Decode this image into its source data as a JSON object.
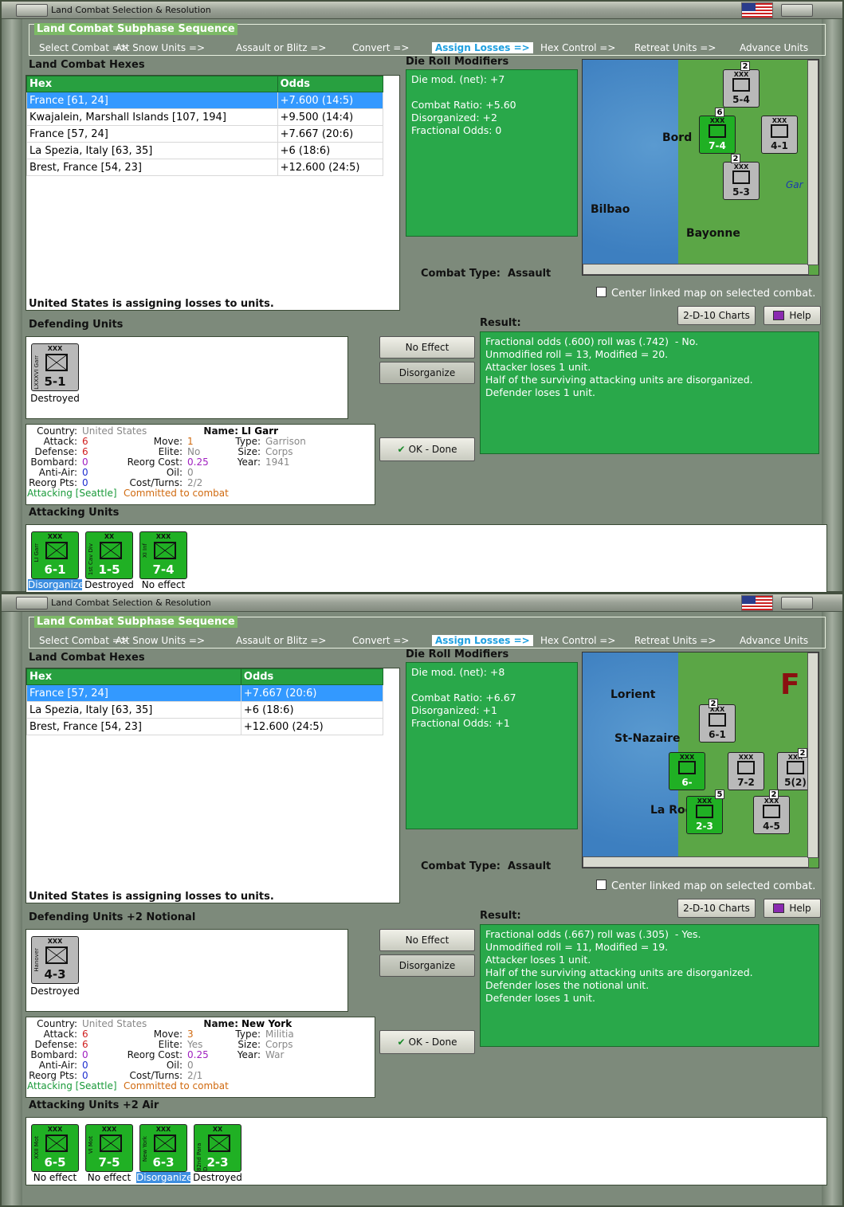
{
  "windows": [
    {
      "title": "Land Combat Selection & Resolution",
      "seq_title": "Land Combat Subphase Sequence",
      "sequence": [
        "Select Combat =>",
        "Att Snow Units =>",
        "Assault or Blitz =>",
        "Convert =>",
        "Assign Losses =>",
        "Hex Control =>",
        "Retreat Units =>",
        "Advance Units"
      ],
      "active_step": "Assign Losses =>",
      "hexes_label": "Land Combat Hexes",
      "col_hex": "Hex",
      "col_odds": "Odds",
      "hexes": [
        {
          "hex": "France [61, 24]",
          "odds": "+7.600 (14:5)"
        },
        {
          "hex": "Kwajalein, Marshall Islands [107, 194]",
          "odds": "+9.500 (14:4)"
        },
        {
          "hex": "France [57, 24]",
          "odds": "+7.667 (20:6)"
        },
        {
          "hex": "La Spezia, Italy [63, 35]",
          "odds": "+6 (18:6)"
        },
        {
          "hex": "Brest, France [54, 23]",
          "odds": "+12.600 (24:5)"
        }
      ],
      "drm_label": "Die Roll Modifiers",
      "drm": [
        "Die mod. (net): +7",
        "",
        "Combat Ratio: +5.60",
        "Disorganized: +2",
        "Fractional Odds: 0"
      ],
      "combat_type_label": "Combat Type:",
      "combat_type": "Assault",
      "center_map": "Center linked map on selected combat.",
      "assign_msg": "United States is assigning losses to units.",
      "defending_label": "Defending Units",
      "defender": {
        "name": "LXXXVI Garr",
        "size": "XXX",
        "strength": "5-1",
        "status": "Destroyed"
      },
      "charts_btn": "2-D-10 Charts",
      "help_btn": "Help",
      "no_effect_btn": "No Effect",
      "disorganize_btn": "Disorganize",
      "ok_btn": "OK - Done",
      "result_label": "Result:",
      "result": [
        "Fractional odds (.600) roll was (.742)  - No.",
        "Unmodified roll = 13, Modified = 20.",
        "Attacker loses 1 unit.",
        "Half of the surviving attacking units are disorganized.",
        "Defender loses 1 unit."
      ],
      "info": {
        "country_k": "Country:",
        "country": "United States",
        "name_k": "Name:",
        "name": "LI Garr",
        "attack_k": "Attack:",
        "attack": "6",
        "move_k": "Move:",
        "move": "1",
        "type_k": "Type:",
        "type": "Garrison",
        "defense_k": "Defense:",
        "defense": "6",
        "elite_k": "Elite:",
        "elite": "No",
        "size_k": "Size:",
        "size": "Corps",
        "bombard_k": "Bombard:",
        "bombard": "0",
        "reorg_k": "Reorg Cost:",
        "reorg": "0.25",
        "year_k": "Year:",
        "year": "1941",
        "aa_k": "Anti-Air:",
        "aa": "0",
        "oil_k": "Oil:",
        "oil": "0",
        "rp_k": "Reorg Pts:",
        "rp": "0",
        "ct_k": "Cost/Turns:",
        "ct": "2/2",
        "attacking": "Attacking [Seattle]",
        "committed": "Committed to combat"
      },
      "attacking_label": "Attacking Units",
      "attackers": [
        {
          "name": "LI Garr",
          "size": "XXX",
          "strength": "6-1",
          "status": "Disorganized",
          "sel": true
        },
        {
          "name": "1st Cav Div",
          "size": "XX",
          "strength": "1-5",
          "status": "Destroyed",
          "sel": false
        },
        {
          "name": "XI Inf",
          "size": "XXX",
          "strength": "7-4",
          "status": "No effect",
          "sel": false
        }
      ],
      "map": {
        "cities": [
          "Bord",
          "Bilbao",
          "Bayonne",
          "Gar"
        ],
        "units": [
          "5-4",
          "7-4",
          "4-1",
          "5-3"
        ],
        "markers": [
          "2",
          "6",
          "2"
        ]
      }
    },
    {
      "title": "Land Combat Selection & Resolution",
      "seq_title": "Land Combat Subphase Sequence",
      "sequence": [
        "Select Combat =>",
        "Att Snow Units =>",
        "Assault or Blitz =>",
        "Convert =>",
        "Assign Losses =>",
        "Hex Control =>",
        "Retreat Units =>",
        "Advance Units"
      ],
      "active_step": "Assign Losses =>",
      "hexes_label": "Land Combat Hexes",
      "col_hex": "Hex",
      "col_odds": "Odds",
      "hexes": [
        {
          "hex": "France [57, 24]",
          "odds": "+7.667 (20:6)"
        },
        {
          "hex": "La Spezia, Italy [63, 35]",
          "odds": "+6 (18:6)"
        },
        {
          "hex": "Brest, France [54, 23]",
          "odds": "+12.600 (24:5)"
        }
      ],
      "drm_label": "Die Roll Modifiers",
      "drm": [
        "Die mod. (net): +8",
        "",
        "Combat Ratio: +6.67",
        "Disorganized: +1",
        "Fractional Odds: +1"
      ],
      "combat_type_label": "Combat Type:",
      "combat_type": "Assault",
      "center_map": "Center linked map on selected combat.",
      "assign_msg": "United States is assigning losses to units.",
      "defending_label": "Defending Units +2 Notional",
      "defender": {
        "name": "Hanover",
        "size": "XXX",
        "strength": "4-3",
        "status": "Destroyed"
      },
      "charts_btn": "2-D-10 Charts",
      "help_btn": "Help",
      "no_effect_btn": "No Effect",
      "disorganize_btn": "Disorganize",
      "ok_btn": "OK - Done",
      "result_label": "Result:",
      "result": [
        "Fractional odds (.667) roll was (.305)  - Yes.",
        "Unmodified roll = 11, Modified = 19.",
        "Attacker loses 1 unit.",
        "Half of the surviving attacking units are disorganized.",
        "Defender loses the notional unit.",
        "Defender loses 1 unit."
      ],
      "info": {
        "country_k": "Country:",
        "country": "United States",
        "name_k": "Name:",
        "name": "New York",
        "attack_k": "Attack:",
        "attack": "6",
        "move_k": "Move:",
        "move": "3",
        "type_k": "Type:",
        "type": "Militia",
        "defense_k": "Defense:",
        "defense": "6",
        "elite_k": "Elite:",
        "elite": "Yes",
        "size_k": "Size:",
        "size": "Corps",
        "bombard_k": "Bombard:",
        "bombard": "0",
        "reorg_k": "Reorg Cost:",
        "reorg": "0.25",
        "year_k": "Year:",
        "year": "War",
        "aa_k": "Anti-Air:",
        "aa": "0",
        "oil_k": "Oil:",
        "oil": "0",
        "rp_k": "Reorg Pts:",
        "rp": "0",
        "ct_k": "Cost/Turns:",
        "ct": "2/1",
        "attacking": "Attacking [Seattle]",
        "committed": "Committed to combat"
      },
      "attacking_label": "Attacking Units +2 Air",
      "attackers": [
        {
          "name": "XXII Mot",
          "size": "XXX",
          "strength": "6-5",
          "status": "No effect",
          "sel": false
        },
        {
          "name": "VI Mot",
          "size": "XXX",
          "strength": "7-5",
          "status": "No effect",
          "sel": false
        },
        {
          "name": "New York",
          "size": "XXX",
          "strength": "6-3",
          "status": "Disorganized",
          "sel": true
        },
        {
          "name": "82nd Para D.",
          "size": "XX",
          "strength": "2-3",
          "status": "Destroyed",
          "sel": false
        }
      ],
      "map": {
        "cities": [
          "Lorient",
          "St-Nazaire",
          "La Roch",
          "F"
        ],
        "units": [
          "6-1",
          "6-",
          "7-2",
          "5(2)",
          "2-3",
          "4-5"
        ],
        "markers": [
          "2",
          "5",
          "2",
          "2"
        ]
      }
    }
  ]
}
